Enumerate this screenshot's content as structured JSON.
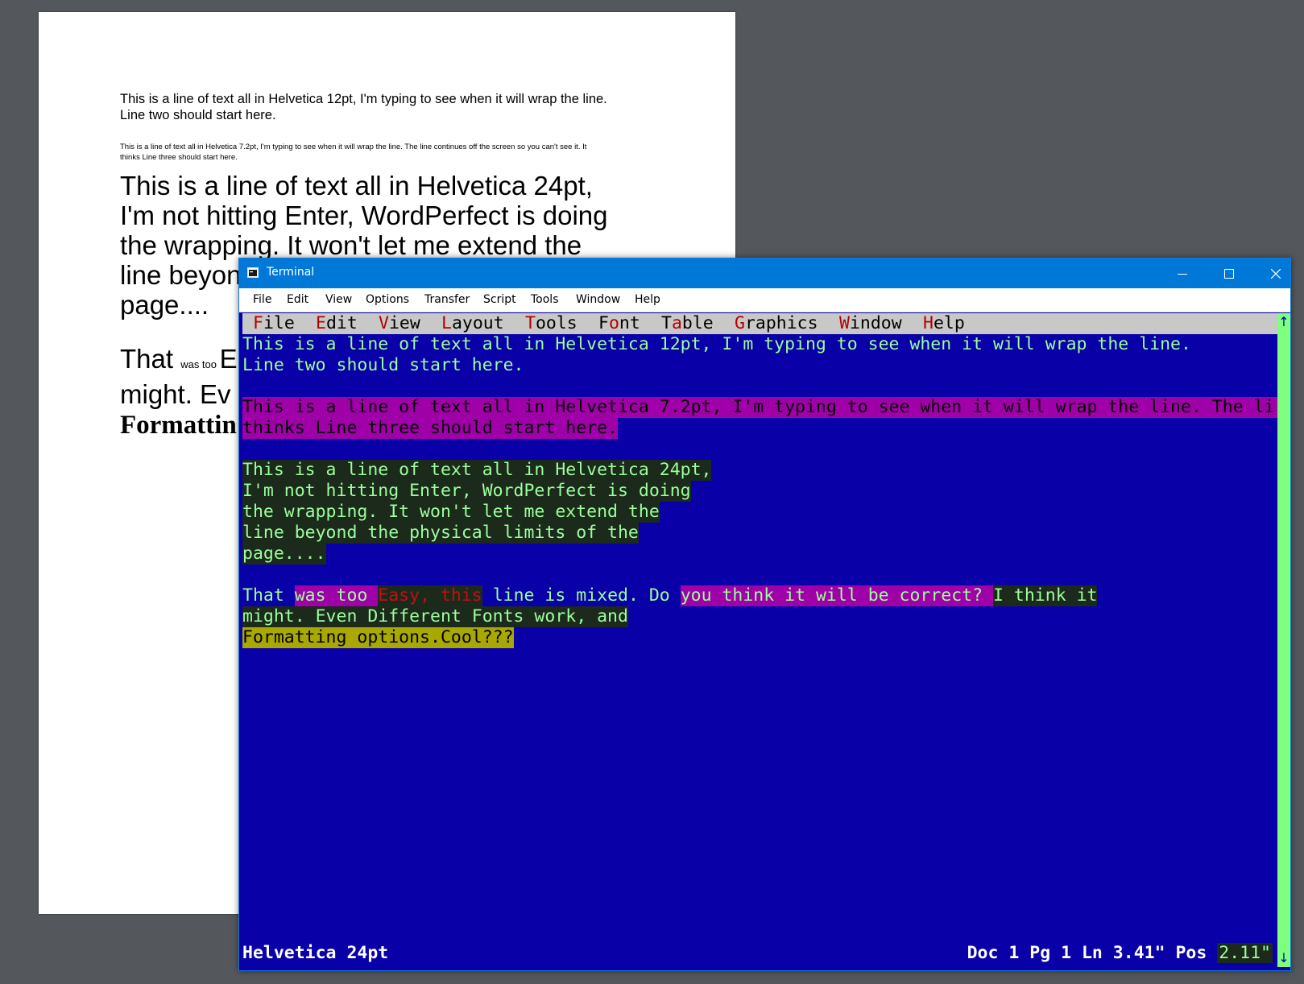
{
  "page": {
    "line12_a": "This is a line of text all in Helvetica 12pt, I'm typing to see when it will wrap the line.",
    "line12_b": "Line two should start here.",
    "line72_a": "This is a line of text all in Helvetica 7.2pt, I'm typing to see when it will wrap the line. The line continues off the screen so you can't see it. It",
    "line72_b": "thinks Line three should start here.",
    "line24": [
      "This is a line of text all in Helvetica 24pt,",
      "I'm not hitting Enter, WordPerfect is doing",
      "the wrapping. It won't let me extend the",
      "line beyond the physical limits of the",
      "page...."
    ],
    "mix_line1_a": "That ",
    "mix_line1_small": "was too ",
    "mix_line1_b": "E",
    "mix_line2": "might. Ev",
    "mix_line3": "Formattin"
  },
  "terminal": {
    "title": "Terminal",
    "menu": [
      "File",
      "Edit",
      "View",
      "Options",
      "Transfer",
      "Script",
      "Tools",
      "Window",
      "Help"
    ],
    "controls": {
      "minimize": "minimize",
      "maximize": "maximize",
      "close": "close"
    }
  },
  "wp": {
    "menu": [
      {
        "hot": "F",
        "rest": "ile"
      },
      {
        "hot": "E",
        "rest": "dit"
      },
      {
        "hot": "V",
        "rest": "iew"
      },
      {
        "hot": "L",
        "rest": "ayout"
      },
      {
        "hot": "T",
        "rest": "ools"
      },
      {
        "pre": "F",
        "hot": "o",
        "rest": "nt"
      },
      {
        "pre": "T",
        "hot": "a",
        "rest": "ble"
      },
      {
        "hot": "G",
        "rest": "raphics"
      },
      {
        "hot": "W",
        "rest": "indow"
      },
      {
        "hot": "H",
        "rest": "elp"
      }
    ],
    "text": {
      "l1": "This is a line of text all in Helvetica 12pt, I'm typing to see when it will wrap the line.",
      "l2": "Line two should start here.",
      "l3": "This is a line of text all in Helvetica 7.2pt, I'm typing to see when it will wrap the line. The li",
      "l4": "thinks Line three should start here.",
      "l5": "This is a line of text all in Helvetica 24pt,",
      "l6": "I'm not hitting Enter, WordPerfect is doing",
      "l7": "the wrapping. It won't let me extend the",
      "l8": "line beyond the physical limits of the",
      "l9": "page....",
      "m1": "That ",
      "m2": "was too ",
      "m3": "Easy, this",
      "m4": " line is mixed. Do ",
      "m5": "you think it will be correct? ",
      "m6": "I think it",
      "l11": "might. Even Different Fonts work, and",
      "l12": "Formatting options.Cool???"
    },
    "status": {
      "font": "Helvetica 24pt",
      "position": "Doc 1 Pg 1 Ln 3.41\" Pos ",
      "pos_value": "2.11\""
    },
    "scroll": {
      "up": "↑",
      "down": "↓"
    },
    "colors": {
      "screen_bg": "#0a00a8",
      "text_green": "#9cff9c",
      "highlight_magenta": "#a000a8",
      "highlight_olive": "#a8a800",
      "highlight_dark": "#1c2a1c",
      "hotkey_red": "#b20000"
    }
  }
}
